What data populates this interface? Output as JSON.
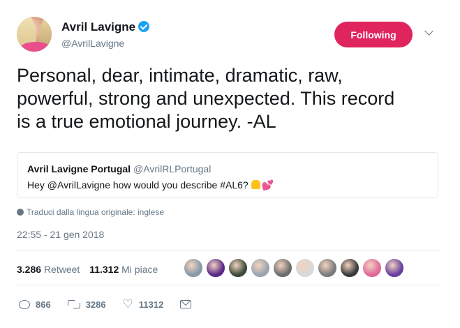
{
  "author": {
    "name": "Avril Lavigne",
    "handle": "@AvrilLavigne",
    "verified": true,
    "follow_label": "Following",
    "follow_color": "#e0245e"
  },
  "tweet": {
    "text": "Personal, dear, intimate, dramatic, raw,\npowerful, strong and  unexpected. This record\nis a true emotional  journey.  -AL"
  },
  "quoted": {
    "name": "Avril Lavigne Portugal",
    "handle": "@AvrilRLPortugal",
    "text": "Hey @AvrilLavigne how would you describe #AL6?",
    "emojis": [
      "folded-hands-emoji",
      "two-hearts-emoji"
    ]
  },
  "translate_label": "Traduci dalla lingua originale: inglese",
  "timestamp": "22:55 - 21 gen 2018",
  "stats": {
    "retweets_count": "3.286",
    "retweets_label": "Retweet",
    "likes_count": "11.312",
    "likes_label": "Mi piace"
  },
  "likers": [
    {
      "color": "#8899a6"
    },
    {
      "color": "#5b2a86"
    },
    {
      "color": "#3d4a3a"
    },
    {
      "color": "#9aa5b1"
    },
    {
      "color": "#6d6d6d"
    },
    {
      "color": "#d9d9d9"
    },
    {
      "color": "#7b7b7b"
    },
    {
      "color": "#3a3a3a"
    },
    {
      "color": "#e06a9a"
    },
    {
      "color": "#6b3fa0"
    }
  ],
  "actions": {
    "replies": "866",
    "retweets": "3286",
    "likes": "11312"
  }
}
